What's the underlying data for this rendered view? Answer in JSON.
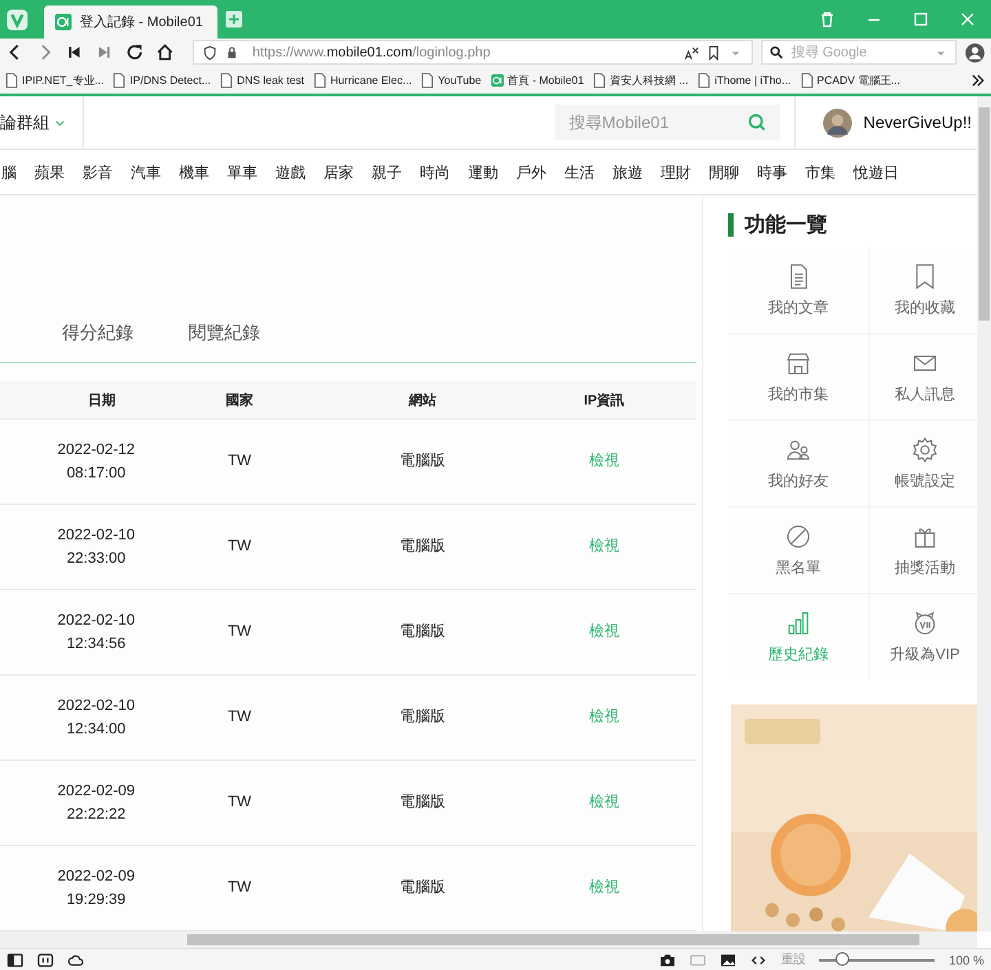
{
  "browser": {
    "tab_title": "登入記錄 - Mobile01",
    "url_scheme": "https://www.",
    "url_domain": "mobile01.com",
    "url_path": "/loginlog.php",
    "search_placeholder": "搜尋 Google",
    "bookmarks": [
      {
        "label": "IPIP.NET_专业...",
        "kind": "page"
      },
      {
        "label": "IP/DNS Detect...",
        "kind": "page"
      },
      {
        "label": "DNS leak test",
        "kind": "page"
      },
      {
        "label": "Hurricane Elec...",
        "kind": "page"
      },
      {
        "label": "YouTube",
        "kind": "page"
      },
      {
        "label": "首頁 - Mobile01",
        "kind": "site"
      },
      {
        "label": "資安人科技網 ...",
        "kind": "page"
      },
      {
        "label": "iThome | iTho...",
        "kind": "page"
      },
      {
        "label": "PCADV 電腦王...",
        "kind": "page"
      }
    ],
    "reset": "重設",
    "zoom": "100 %",
    "zoom_slider": {
      "level": 0.2
    }
  },
  "site": {
    "group_menu": "論群組",
    "search_placeholder": "搜尋Mobile01",
    "username": "NeverGiveUp!!",
    "categories": [
      "腦",
      "蘋果",
      "影音",
      "汽車",
      "機車",
      "單車",
      "遊戲",
      "居家",
      "親子",
      "時尚",
      "運動",
      "戶外",
      "生活",
      "旅遊",
      "理財",
      "閒聊",
      "時事",
      "市集",
      "悅遊日"
    ]
  },
  "tabs": [
    {
      "label": "得分紀錄",
      "selected": false
    },
    {
      "label": "閱覽紀錄",
      "selected": false
    }
  ],
  "table": {
    "columns": [
      "日期",
      "國家",
      "網站",
      "IP資訊"
    ],
    "rows": [
      {
        "date": "2022-02-12",
        "time": "08:17:00",
        "country": "TW",
        "site": "電腦版",
        "ip": "檢視"
      },
      {
        "date": "2022-02-10",
        "time": "22:33:00",
        "country": "TW",
        "site": "電腦版",
        "ip": "檢視"
      },
      {
        "date": "2022-02-10",
        "time": "12:34:56",
        "country": "TW",
        "site": "電腦版",
        "ip": "檢視"
      },
      {
        "date": "2022-02-10",
        "time": "12:34:00",
        "country": "TW",
        "site": "電腦版",
        "ip": "檢視"
      },
      {
        "date": "2022-02-09",
        "time": "22:22:22",
        "country": "TW",
        "site": "電腦版",
        "ip": "檢視"
      },
      {
        "date": "2022-02-09",
        "time": "19:29:39",
        "country": "TW",
        "site": "電腦版",
        "ip": "檢視"
      }
    ]
  },
  "sidebar": {
    "title": "功能一覽",
    "items": [
      {
        "label": "我的文章",
        "kind": "doc",
        "selected": false
      },
      {
        "label": "我的收藏",
        "kind": "bookmark",
        "selected": false
      },
      {
        "label": "我的市集",
        "kind": "shop",
        "selected": false
      },
      {
        "label": "私人訊息",
        "kind": "mail",
        "selected": false
      },
      {
        "label": "我的好友",
        "kind": "friends",
        "selected": false
      },
      {
        "label": "帳號設定",
        "kind": "gear",
        "selected": false
      },
      {
        "label": "黑名單",
        "kind": "ban",
        "selected": false
      },
      {
        "label": "抽獎活動",
        "kind": "gift",
        "selected": false
      },
      {
        "label": "歷史紀錄",
        "kind": "chart",
        "selected": true
      },
      {
        "label": "升級為VIP",
        "kind": "vip",
        "selected": false
      }
    ]
  }
}
